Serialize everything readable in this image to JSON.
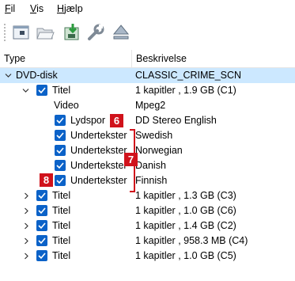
{
  "menu": [
    {
      "label": "Fil",
      "accel": "F",
      "rest": "il"
    },
    {
      "label": "Vis",
      "accel": "V",
      "rest": "is"
    },
    {
      "label": "Hjælp",
      "accel": "H",
      "rest": "jælp"
    }
  ],
  "toolbar": {
    "buttons": [
      "open-disc-icon",
      "open-folder-icon",
      "save-icon",
      "settings-wrench-icon",
      "eject-icon"
    ]
  },
  "columns": {
    "type": "Type",
    "description": "Beskrivelse"
  },
  "tree": {
    "dvd": {
      "name": "DVD-disk",
      "desc": "CLASSIC_CRIME_SCN"
    },
    "title1": {
      "name": "Titel",
      "desc": "1 kapitler , 1.9 GB (C1)"
    },
    "video": {
      "name": "Video",
      "desc": "Mpeg2"
    },
    "audio": {
      "name": "Lydspor",
      "desc": "DD Stereo English"
    },
    "subs": [
      {
        "name": "Undertekster",
        "desc": "Swedish"
      },
      {
        "name": "Undertekster",
        "desc": "Norwegian"
      },
      {
        "name": "Undertekster",
        "desc": "Danish"
      },
      {
        "name": "Undertekster",
        "desc": "Finnish"
      }
    ],
    "titles": [
      {
        "name": "Titel",
        "desc": "1 kapitler , 1.3 GB (C3)"
      },
      {
        "name": "Titel",
        "desc": "1 kapitler , 1.0 GB (C6)"
      },
      {
        "name": "Titel",
        "desc": "1 kapitler , 1.4 GB (C2)"
      },
      {
        "name": "Titel",
        "desc": "1 kapitler , 958.3 MB (C4)"
      },
      {
        "name": "Titel",
        "desc": "1 kapitler , 1.0 GB (C5)"
      }
    ]
  },
  "annotations": {
    "six": "6",
    "seven": "7",
    "eight": "8"
  },
  "colors": {
    "selection": "#cce8ff",
    "checkbox": "#0b62c8",
    "annotation": "#d0121b"
  }
}
